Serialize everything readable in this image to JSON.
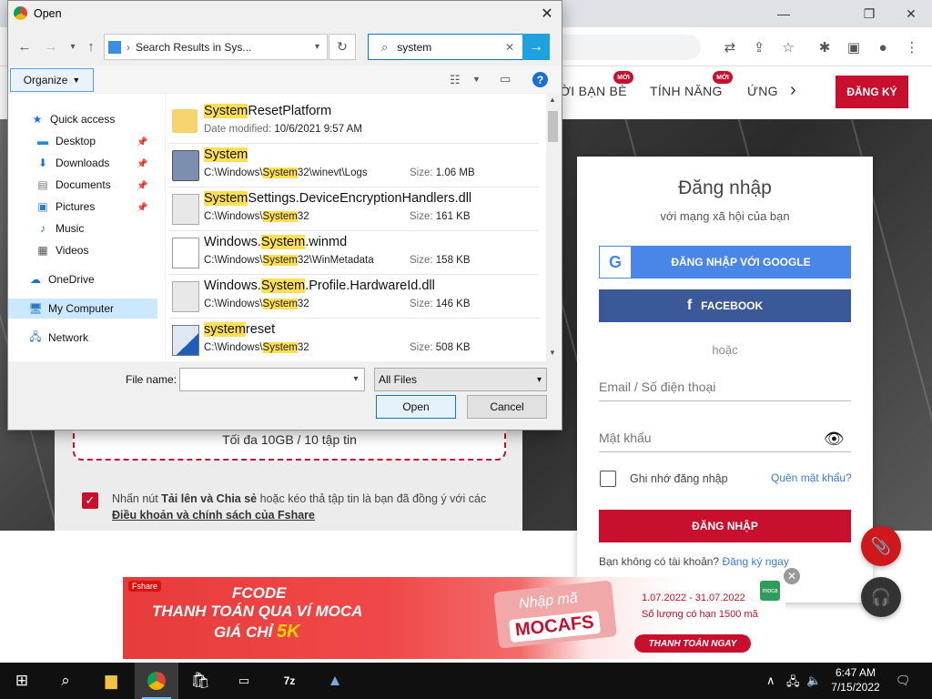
{
  "browser": {
    "window_controls": {
      "minimize": "—",
      "restore": "❐",
      "close": "✕"
    },
    "site_nav": {
      "items": [
        "ỜI BẠN BÈ",
        "TÍNH NĂNG",
        "ỨNG"
      ],
      "badges": [
        "MỚI",
        "MỚI"
      ],
      "more": "›",
      "signup": "ĐĂNG KÝ"
    },
    "upload": {
      "limit_text": "Tối đa 10GB / 10 tập tin",
      "agree_prefix": "Nhấn nút ",
      "agree_bold": "Tải lên và Chia sẻ",
      "agree_suffix": " hoặc kéo thả tập tin là bạn đã đồng ý với các",
      "agree_link": "Điều khoản và chính sách của Fshare"
    },
    "login": {
      "title": "Đăng nhập",
      "subtitle": "với mạng xã hội của bạn",
      "google": "ĐĂNG NHẬP VỚI GOOGLE",
      "facebook": "FACEBOOK",
      "or": "hoặc",
      "email_placeholder": "Email / Số điện thoại",
      "password_placeholder": "Mật khẩu",
      "remember": "Ghi nhớ đăng nhập",
      "forgot": "Quên mật khẩu?",
      "submit": "ĐĂNG NHẬP",
      "no_account": "Bạn không có tài khoản?",
      "register_link": "Đăng ký ngay"
    },
    "ad": {
      "brand": "Fshare",
      "line1": "FCODE",
      "line2": "THANH TOÁN QUA VÍ MOCA",
      "line3_prefix": "GIÁ CHỈ ",
      "line3_price": "5K",
      "code_label": "Nhập mã",
      "code": "MOCAFS",
      "dates": "1.07.2022 - 31.07.2022",
      "limit": "Số lượng có hạn 1500 mã",
      "cta": "THANH TOÁN NGAY",
      "partner": "moca"
    }
  },
  "dialog": {
    "title": "Open",
    "path": "Search Results in Sys...",
    "search_value": "system",
    "organize": "Organize",
    "nav": [
      {
        "label": "Quick access",
        "icon": "star-icon"
      },
      {
        "label": "Desktop",
        "icon": "desktop-icon",
        "pinned": true
      },
      {
        "label": "Downloads",
        "icon": "download-icon",
        "pinned": true
      },
      {
        "label": "Documents",
        "icon": "document-icon",
        "pinned": true
      },
      {
        "label": "Pictures",
        "icon": "pictures-icon",
        "pinned": true
      },
      {
        "label": "Music",
        "icon": "music-icon"
      },
      {
        "label": "Videos",
        "icon": "video-icon"
      },
      {
        "label": "OneDrive",
        "icon": "cloud-icon"
      },
      {
        "label": "My Computer",
        "icon": "computer-icon"
      },
      {
        "label": "Network",
        "icon": "network-icon"
      }
    ],
    "files": [
      {
        "pre": "",
        "hl": "System",
        "post": "ResetPlatform",
        "detail_label": "Date modified: ",
        "detail": "10/6/2021 9:57 AM",
        "size": ""
      },
      {
        "pre": "",
        "hl": "System",
        "post": "",
        "path_pre": "C:\\Windows\\",
        "path_hl": "System",
        "path_post": "32\\winevt\\Logs",
        "size": "1.06 MB"
      },
      {
        "pre": "",
        "hl": "System",
        "post": "Settings.DeviceEncryptionHandlers.dll",
        "path_pre": "C:\\Windows\\",
        "path_hl": "System",
        "path_post": "32",
        "size": "161 KB"
      },
      {
        "pre": "Windows.",
        "hl": "System",
        "post": ".winmd",
        "path_pre": "C:\\Windows\\",
        "path_hl": "System",
        "path_post": "32\\WinMetadata",
        "size": "158 KB"
      },
      {
        "pre": "Windows.",
        "hl": "System",
        "post": ".Profile.HardwareId.dll",
        "path_pre": "C:\\Windows\\",
        "path_hl": "System",
        "path_post": "32",
        "size": "146 KB"
      },
      {
        "pre": "",
        "hl": "system",
        "post": "reset",
        "path_pre": "C:\\Windows\\",
        "path_hl": "System",
        "path_post": "32",
        "size": "508 KB"
      }
    ],
    "size_label": "Size:",
    "file_name_label": "File name:",
    "file_name_value": "",
    "filter": "All Files",
    "open": "Open",
    "cancel": "Cancel"
  },
  "taskbar": {
    "time": "6:47 AM",
    "date": "7/15/2022"
  }
}
